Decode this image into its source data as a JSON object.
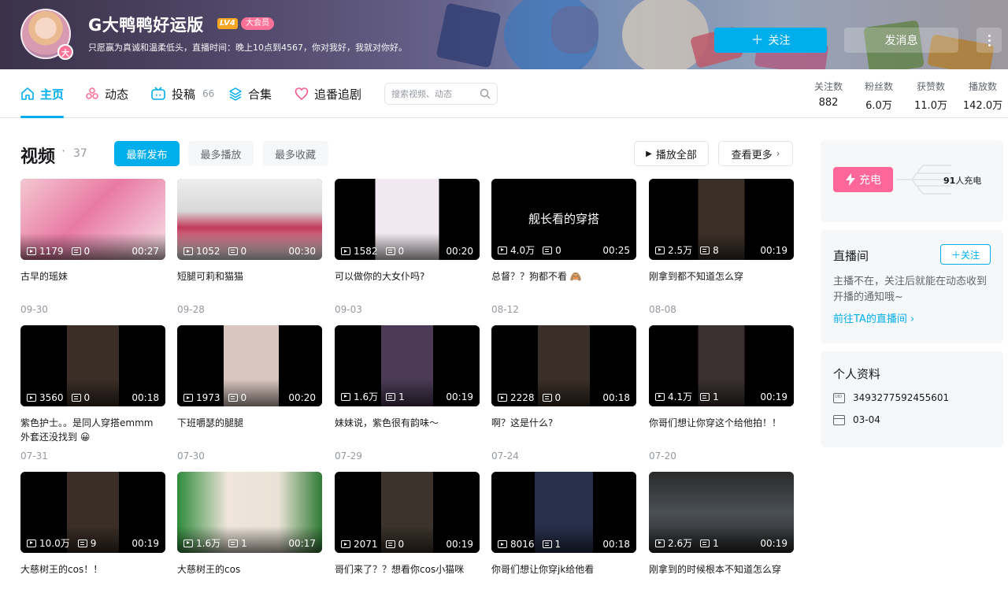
{
  "header": {
    "avatar_badge": "大",
    "name": "G大鸭鸭好运版",
    "level": "LV4",
    "vip": "大会员",
    "signature": "只愿赢为真诚和温柔低头，直播时间：晚上10点到4567，你对我好，我就对你好。",
    "follow_label": "关注",
    "message_label": "发消息"
  },
  "nav": {
    "tabs": [
      {
        "label": "主页",
        "icon": "home-icon"
      },
      {
        "label": "动态",
        "icon": "dynamic-icon"
      },
      {
        "label": "投稿",
        "count": "66",
        "icon": "tv-icon"
      },
      {
        "label": "合集",
        "icon": "layers-icon"
      },
      {
        "label": "追番追剧",
        "icon": "heart-icon"
      }
    ],
    "search_placeholder": "搜索视频、动态",
    "stats": [
      {
        "label": "关注数",
        "value": "882"
      },
      {
        "label": "粉丝数",
        "value": "6.0万"
      },
      {
        "label": "获赞数",
        "value": "11.0万"
      },
      {
        "label": "播放数",
        "value": "142.0万"
      }
    ]
  },
  "videos_section": {
    "title": "视频",
    "dot": "·",
    "count": "37",
    "sort": [
      "最新发布",
      "最多播放",
      "最多收藏"
    ],
    "play_all": "播放全部",
    "see_more": "查看更多"
  },
  "videos": [
    {
      "title": "古早的瑶妹",
      "plays": "1179",
      "danmaku": "0",
      "duration": "00:27",
      "date": "09-30",
      "cover_text": ""
    },
    {
      "title": "短腿可莉和猫猫",
      "plays": "1052",
      "danmaku": "0",
      "duration": "00:30",
      "date": "09-28",
      "cover_text": ""
    },
    {
      "title": "可以做你的大女仆吗?",
      "plays": "1582",
      "danmaku": "0",
      "duration": "00:20",
      "date": "09-03",
      "cover_text": ""
    },
    {
      "title": "总督？？狗都不看 🙈",
      "plays": "4.0万",
      "danmaku": "0",
      "duration": "00:25",
      "date": "08-12",
      "cover_text": "舰长看的穿搭"
    },
    {
      "title": "刚拿到都不知道怎么穿",
      "plays": "2.5万",
      "danmaku": "8",
      "duration": "00:19",
      "date": "08-08",
      "cover_text": ""
    },
    {
      "title": "紫色护士。。是同人穿搭emmm 外套还没找到 😀",
      "plays": "3560",
      "danmaku": "0",
      "duration": "00:18",
      "date": "07-31",
      "cover_text": ""
    },
    {
      "title": "下班嚼瑟的腿腿",
      "plays": "1973",
      "danmaku": "0",
      "duration": "00:20",
      "date": "07-30",
      "cover_text": ""
    },
    {
      "title": "妹妹说，紫色很有韵味～",
      "plays": "1.6万",
      "danmaku": "1",
      "duration": "00:19",
      "date": "07-29",
      "cover_text": ""
    },
    {
      "title": "啊？这是什么?",
      "plays": "2228",
      "danmaku": "0",
      "duration": "00:18",
      "date": "07-24",
      "cover_text": ""
    },
    {
      "title": "你哥们想让你穿这个给他拍！！",
      "plays": "4.1万",
      "danmaku": "1",
      "duration": "00:19",
      "date": "07-20",
      "cover_text": ""
    },
    {
      "title": "大慈树王的cos！！",
      "plays": "10.0万",
      "danmaku": "9",
      "duration": "00:19",
      "date": "",
      "cover_text": ""
    },
    {
      "title": "大慈树王的cos",
      "plays": "1.6万",
      "danmaku": "1",
      "duration": "00:17",
      "date": "",
      "cover_text": ""
    },
    {
      "title": "哥们来了？？想看你cos小猫咪",
      "plays": "2071",
      "danmaku": "0",
      "duration": "00:19",
      "date": "",
      "cover_text": ""
    },
    {
      "title": "你哥们想让你穿jk给他看",
      "plays": "8016",
      "danmaku": "1",
      "duration": "00:18",
      "date": "",
      "cover_text": ""
    },
    {
      "title": "刚拿到的时候根本不知道怎么穿",
      "plays": "2.6万",
      "danmaku": "1",
      "duration": "00:19",
      "date": "",
      "cover_text": ""
    }
  ],
  "sidebar": {
    "charge": {
      "label": "充电",
      "count": "91",
      "suffix": "人充电"
    },
    "live": {
      "title": "直播间",
      "follow": "关注",
      "desc": "主播不在，关注后就能在动态收到开播的通知哦~",
      "link": "前往TA的直播间"
    },
    "profile": {
      "title": "个人资料",
      "uid": "3493277592455601",
      "birthday": "03-04"
    }
  },
  "colors": {
    "accent": "#00aeec",
    "pink": "#fb7299",
    "charge": "#ff6699"
  }
}
